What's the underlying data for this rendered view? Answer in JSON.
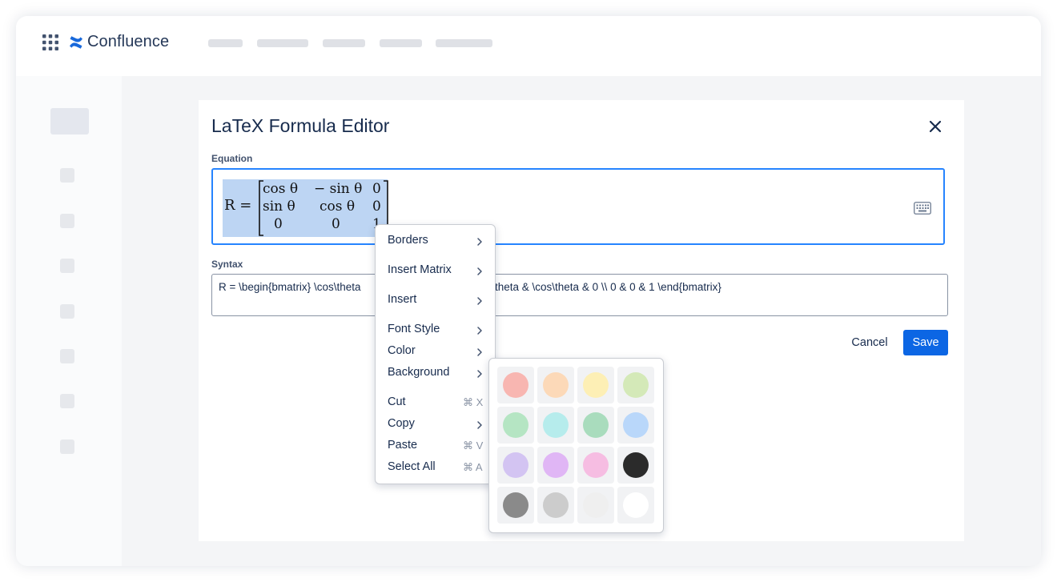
{
  "app": {
    "name": "Confluence",
    "brand_color": "#0c66e4"
  },
  "dialog": {
    "title": "LaTeX Formula Editor",
    "equation_label": "Equation",
    "syntax_label": "Syntax",
    "cancel_label": "Cancel",
    "save_label": "Save"
  },
  "formula": {
    "lhs": "R =",
    "matrix": [
      [
        "cos θ",
        "− sin θ",
        "0"
      ],
      [
        "sin θ",
        "cos θ",
        "0"
      ],
      [
        "0",
        "0",
        "1"
      ]
    ]
  },
  "syntax": {
    "before_menu": "R = \\begin{bmatrix} \\cos\\theta",
    "after_menu": "theta & \\cos\\theta & 0 \\\\ 0 & 0 & 1 \\end{bmatrix}"
  },
  "context_menu": {
    "items": [
      {
        "label": "Borders",
        "submenu": true
      },
      {
        "label": "Insert Matrix",
        "submenu": true
      },
      {
        "label": "Insert",
        "submenu": true
      },
      {
        "label": "Font Style",
        "submenu": true
      },
      {
        "label": "Color",
        "submenu": true
      },
      {
        "label": "Background",
        "submenu": true
      },
      {
        "label": "Cut",
        "shortcut": "⌘ X"
      },
      {
        "label": "Copy",
        "submenu": true
      },
      {
        "label": "Paste",
        "shortcut": "⌘ V"
      },
      {
        "label": "Select All",
        "shortcut": "⌘ A"
      }
    ]
  },
  "background_colors": [
    "#f8b6b1",
    "#fcd9b8",
    "#fdefb5",
    "#d4e9b8",
    "#b5e5c3",
    "#b6ecec",
    "#a9dcbd",
    "#b9d7fa",
    "#d3c4f2",
    "#e0b6f5",
    "#f6bde2",
    "#2b2b2b",
    "#8a8a8a",
    "#cccccc",
    "#efefef",
    "#ffffff"
  ],
  "icons": {
    "app_switcher": "grid-icon",
    "logo": "confluence-logo-icon",
    "close": "close-icon",
    "keyboard": "keyboard-icon",
    "submenu": "chevron-right-icon"
  }
}
